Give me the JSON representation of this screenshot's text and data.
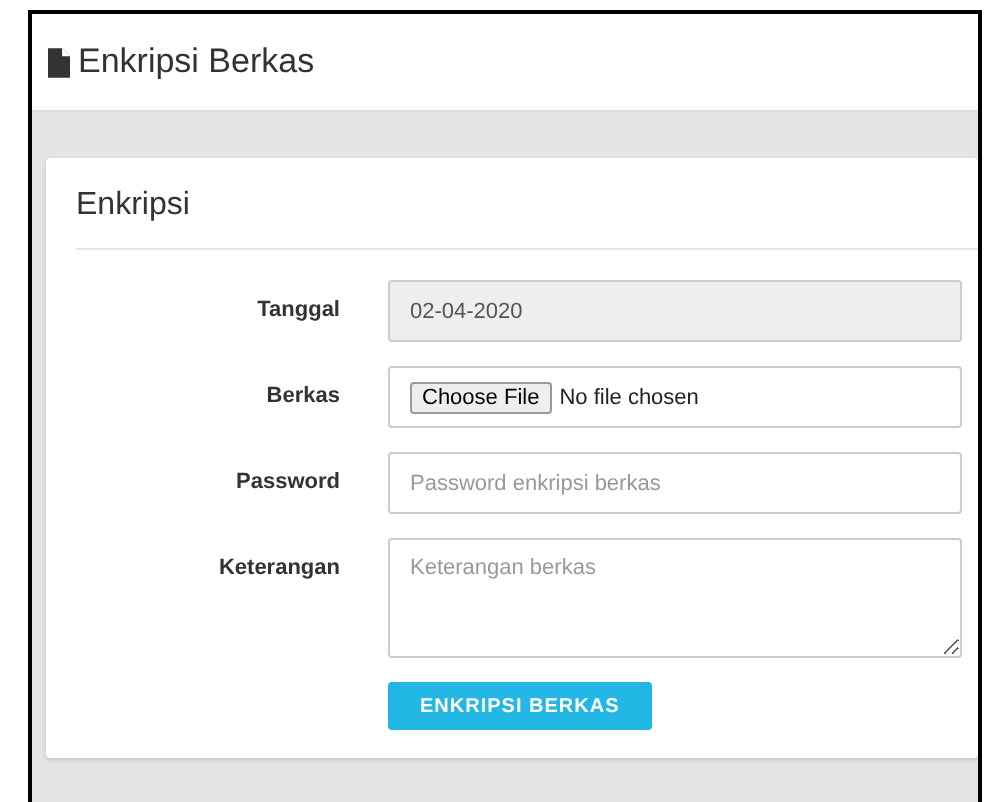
{
  "header": {
    "title": "Enkripsi Berkas"
  },
  "card": {
    "title": "Enkripsi",
    "fields": [
      {
        "kind": "text",
        "label": "Tanggal",
        "value": "02-04-2020",
        "disabled": true
      },
      {
        "kind": "file",
        "label": "Berkas",
        "button": "Choose File",
        "status": "No file chosen",
        "disabled": false
      },
      {
        "kind": "password",
        "label": "Password",
        "placeholder": "Password enkripsi berkas",
        "disabled": false
      },
      {
        "kind": "textarea",
        "label": "Keterangan",
        "placeholder": "Keterangan berkas",
        "disabled": false
      }
    ],
    "submit": "ENKRIPSI BERKAS"
  }
}
